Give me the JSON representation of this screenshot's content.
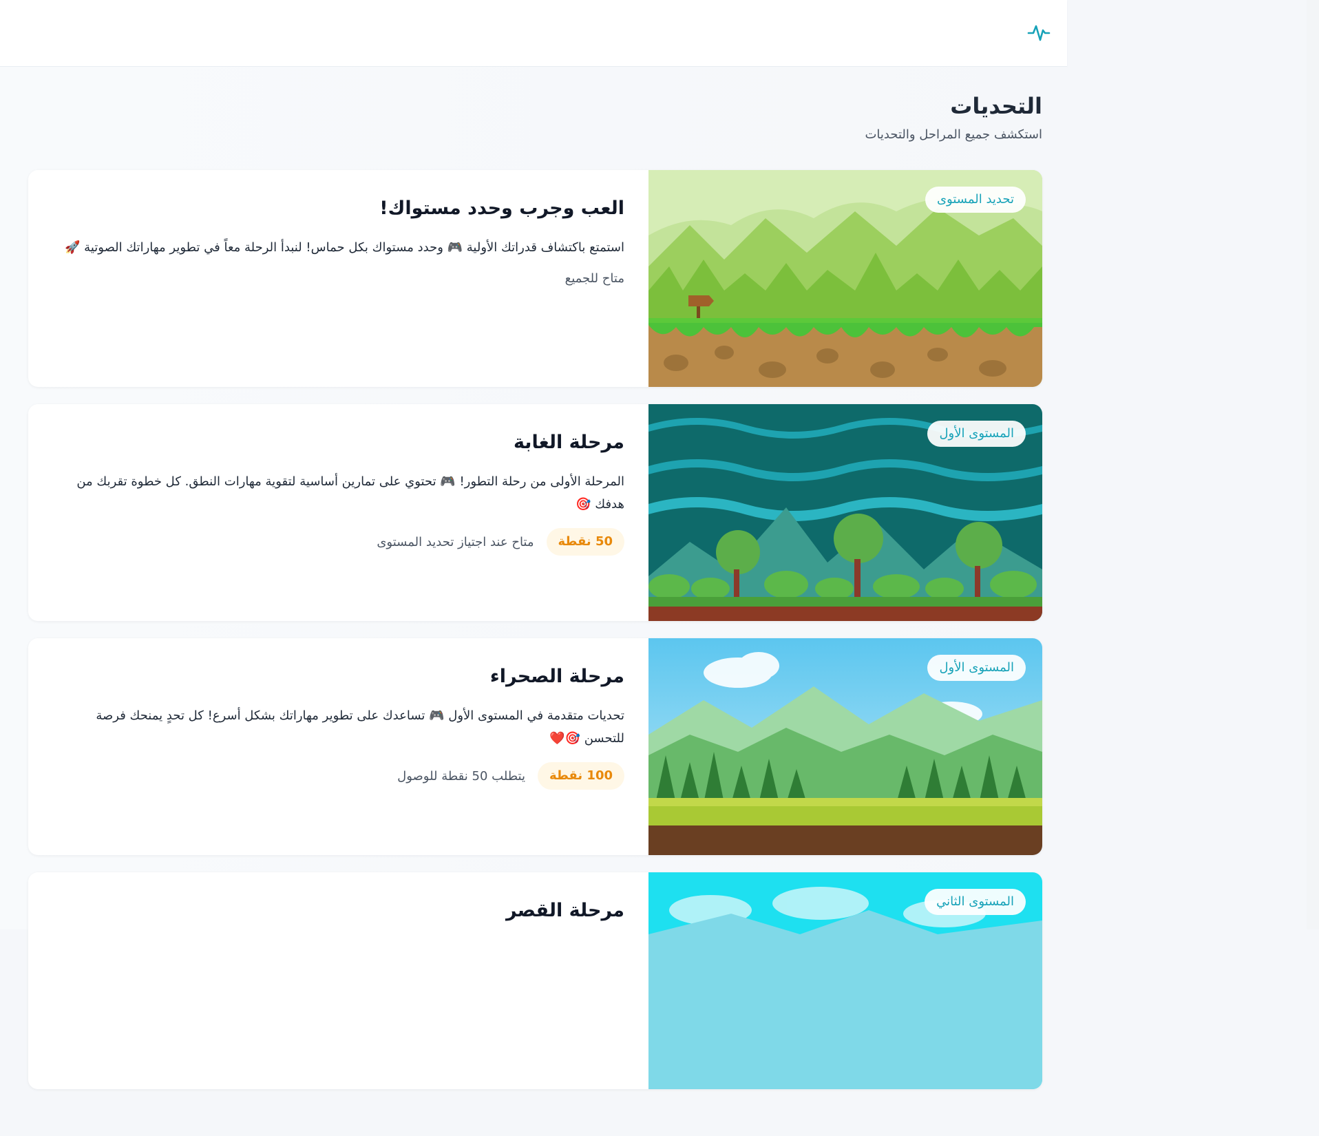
{
  "page": {
    "title": "التحديات",
    "subtitle": "استكشف جميع المراحل والتحديات"
  },
  "challenges": [
    {
      "badge": "تحديد المستوى",
      "title": "العب وجرب وحدد مستواك!",
      "description": "استمتع باكتشاف قدراتك الأولية 🎮 وحدد مستواك بكل حماس! لنبدأ الرحلة معاً في تطوير مهاراتك الصوتية 🚀",
      "points": "",
      "availability": "متاح للجميع",
      "scene": "meadow"
    },
    {
      "badge": "المستوى الأول",
      "title": "مرحلة الغابة",
      "description": "المرحلة الأولى من رحلة التطور! 🎮 تحتوي على تمارين أساسية لتقوية مهارات النطق. كل خطوة تقربك من هدفك 🎯",
      "points": "50 نقطة",
      "availability": "متاح عند اجتياز تحديد المستوى",
      "scene": "teal-forest"
    },
    {
      "badge": "المستوى الأول",
      "title": "مرحلة الصحراء",
      "description": "تحديات متقدمة في المستوى الأول 🎮 تساعدك على تطوير مهاراتك بشكل أسرع! كل تحدٍ يمنحك فرصة للتحسن 🎯❤️",
      "points": "100 نقطة",
      "availability": "يتطلب 50 نقطة للوصول",
      "scene": "green-hills"
    },
    {
      "badge": "المستوى الثاني",
      "title": "مرحلة القصر",
      "description": "",
      "points": "",
      "availability": "",
      "scene": "sky"
    }
  ],
  "icons": {
    "logo": "pulse-icon"
  },
  "colors": {
    "accent": "#17a2b8",
    "points": "#e8890b",
    "points_bg": "#fff7e6"
  }
}
